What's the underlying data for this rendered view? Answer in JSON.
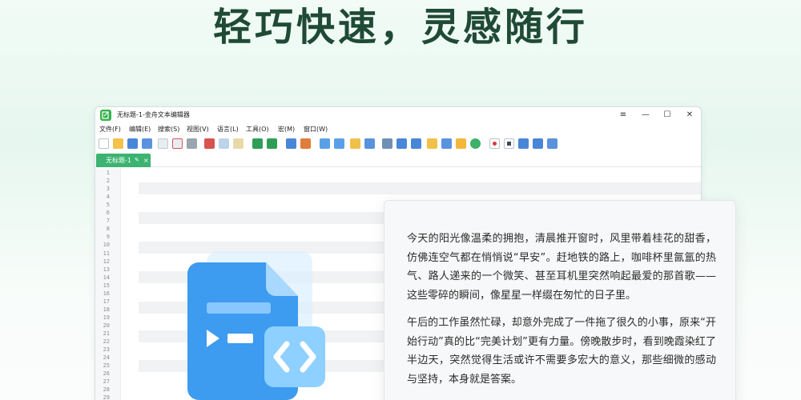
{
  "hero": {
    "title": "轻巧快速，灵感随行"
  },
  "window": {
    "title": "无标题-1-金舟文本编辑器",
    "controls": {
      "menu": "≡",
      "minimize": "—",
      "maximize": "☐",
      "close": "✕"
    }
  },
  "menu": [
    {
      "label": "文件(F)"
    },
    {
      "label": "编辑(E)"
    },
    {
      "label": "搜索(S)"
    },
    {
      "label": "视图(V)"
    },
    {
      "label": "语言(L)"
    },
    {
      "label": "工具(O)"
    },
    {
      "label": "宏(M)"
    },
    {
      "label": "窗口(W)"
    }
  ],
  "toolbar_icons": [
    "new-file-icon",
    "open-folder-icon",
    "save-icon",
    "save-all-icon",
    "close-file-icon",
    "close-all-icon",
    "print-icon",
    "cut-icon",
    "copy-icon",
    "paste-icon",
    "undo-icon",
    "redo-icon",
    "find-icon",
    "replace-icon",
    "zoom-in-icon",
    "zoom-out-icon",
    "sync-vertical-icon",
    "sync-horizontal-icon",
    "word-wrap-icon",
    "show-symbols-icon",
    "indent-guide-icon",
    "doc-map-icon",
    "function-list-icon",
    "folder-workspace-icon",
    "monitor-icon",
    "record-macro-icon",
    "stop-macro-icon",
    "play-macro-icon",
    "run-macro-multiple-icon",
    "save-macro-icon"
  ],
  "tab": {
    "label": "无标题-1",
    "pin": "✎",
    "close": "×"
  },
  "line_numbers": [
    "1",
    "2",
    "3",
    "4",
    "5",
    "6",
    "7",
    "8",
    "9",
    "10",
    "11",
    "12",
    "13",
    "14",
    "15",
    "16",
    "17",
    "18",
    "19",
    "20",
    "21",
    "22",
    "23",
    "24",
    "25",
    "26",
    "27",
    "28",
    "29"
  ],
  "card": {
    "paragraphs": [
      "今天的阳光像温柔的拥抱，清晨推开窗时，风里带着桂花的甜香，仿佛连空气都在悄悄说“早安”。赶地铁的路上，咖啡杯里氤氲的热气、路人递来的一个微笑、甚至耳机里突然响起最爱的那首歌——这些零碎的瞬间，像星星一样缀在匆忙的日子里。",
      "午后的工作虽然忙碌，却意外完成了一件拖了很久的小事，原来“开始行动”真的比“完美计划”更有力量。傍晚散步时，看到晚霞染红了半边天，突然觉得生活或许不需要多宏大的意义，那些细微的感动与坚持，本身就是答案。"
    ]
  },
  "colors": {
    "accent_green": "#3cb371",
    "hero_text": "#1f4a36",
    "file_icon_blue": "#3d9bf0",
    "file_icon_light": "#8ed0ff"
  }
}
